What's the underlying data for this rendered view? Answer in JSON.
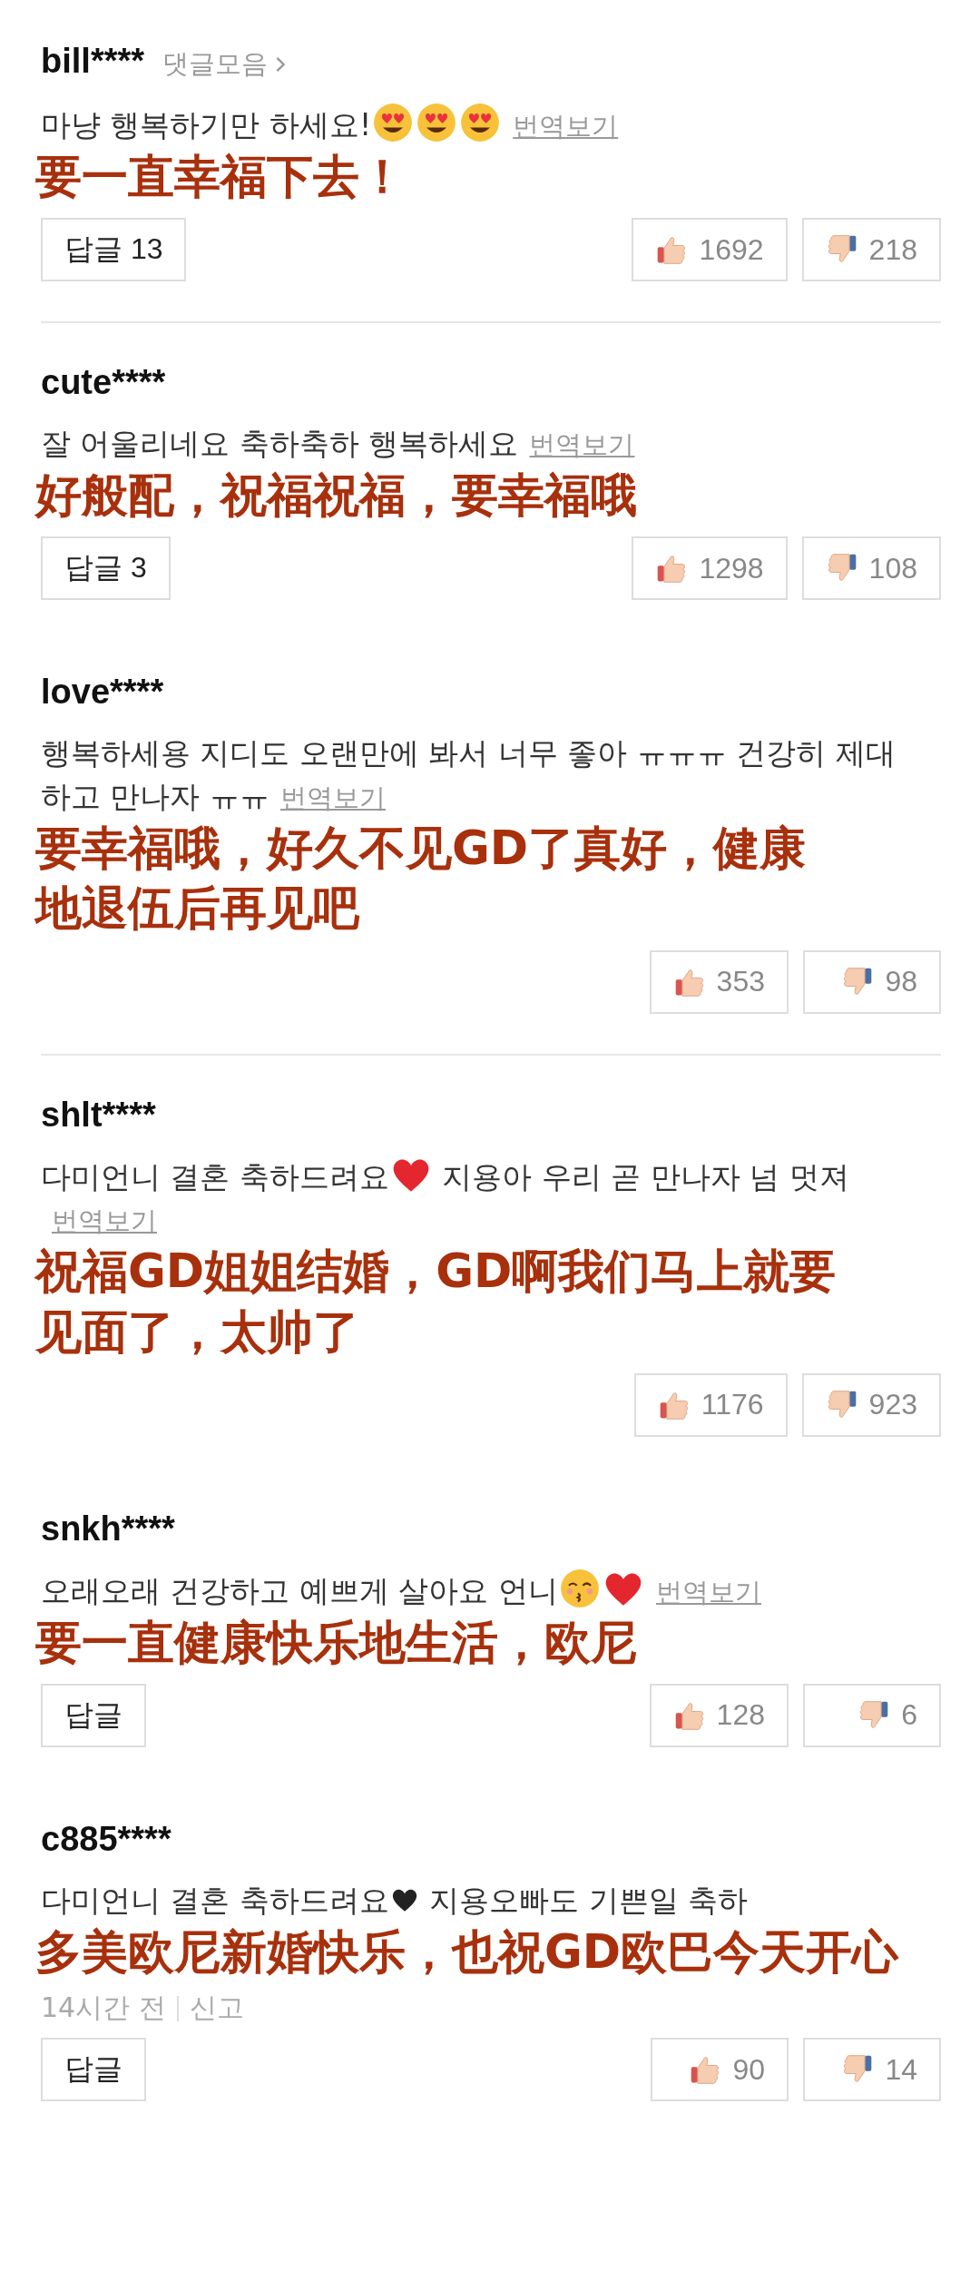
{
  "comments": [
    {
      "user": "bill****",
      "collection_link": "댓글모음",
      "body": [
        {
          "kind": "text",
          "text": "마냥 행복하기만 하세요!"
        },
        {
          "kind": "heart_eyes"
        },
        {
          "kind": "heart_eyes"
        },
        {
          "kind": "heart_eyes"
        }
      ],
      "translate_link": "번역보기",
      "translation_lines": [
        "要一直幸福下去！"
      ],
      "reply": "답글 13",
      "likes": "1692",
      "dislikes": "218",
      "divider_below": true
    },
    {
      "user": "cute****",
      "body": [
        {
          "kind": "text",
          "text": "잘 어울리네요 축하축하 행복하세요"
        }
      ],
      "translate_link": "번역보기",
      "translation_lines": [
        "好般配，祝福祝福，要幸福哦"
      ],
      "reply": "답글 3",
      "likes": "1298",
      "dislikes": "108",
      "divider_below": false
    },
    {
      "user": "love****",
      "body": [
        {
          "kind": "text",
          "text": "행복하세용 지디도 오랜만에 봐서 너무 좋아 ㅠㅠㅠ 건강히 제대하고 만나자 ㅠㅠ"
        }
      ],
      "translate_link": "번역보기",
      "translation_lines": [
        "要幸福哦，好久不见GD了真好，健康",
        "地退伍后再见吧"
      ],
      "likes": "353",
      "dislikes": "98",
      "divider_below": true
    },
    {
      "user": "shlt****",
      "body": [
        {
          "kind": "text",
          "text": "다미언니 결혼 축하드려요"
        },
        {
          "kind": "red_heart"
        },
        {
          "kind": "text",
          "text": " 지용아 우리 곧 만나자 넘 멋져"
        }
      ],
      "translate_link": "번역보기",
      "translation_lines": [
        "祝福GD姐姐结婚，GD啊我们马上就要",
        "见面了，太帅了"
      ],
      "likes": "1176",
      "dislikes": "923",
      "divider_below": false
    },
    {
      "user": "snkh****",
      "body": [
        {
          "kind": "text",
          "text": "오래오래 건강하고 예쁘게 살아요 언니"
        },
        {
          "kind": "kissing"
        },
        {
          "kind": "red_heart"
        }
      ],
      "translate_link": "번역보기",
      "translation_lines": [
        "要一直健康快乐地生活，欧尼"
      ],
      "reply": "답글",
      "likes": "128",
      "dislikes": "6",
      "divider_below": false
    },
    {
      "user": "c885****",
      "body": [
        {
          "kind": "text",
          "text": "다미언니 결혼 축하드려요"
        },
        {
          "kind": "black_heart"
        },
        {
          "kind": "text",
          "text": " 지용오빠도 기쁜일 축하"
        }
      ],
      "translation_lines": [
        "多美欧尼新婚快乐，也祝GD欧巴今天开心"
      ],
      "time": "14시간 전",
      "report": "신고",
      "reply": "답글",
      "likes": "90",
      "dislikes": "14",
      "divider_below": false
    }
  ]
}
